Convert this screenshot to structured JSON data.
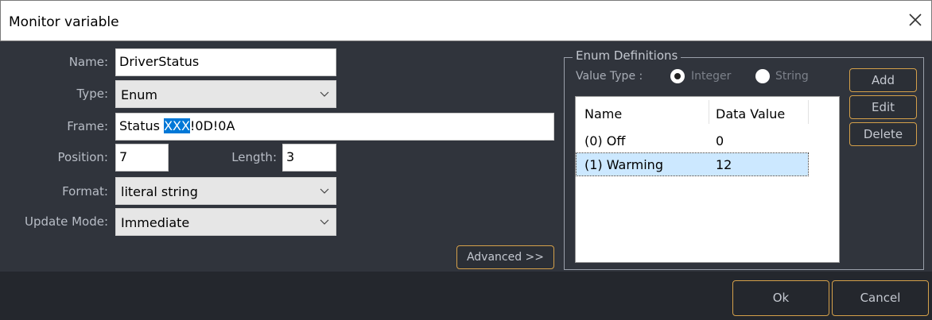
{
  "window": {
    "title": "Monitor variable"
  },
  "form": {
    "name_label": "Name:",
    "name_value": "DriverStatus",
    "type_label": "Type:",
    "type_value": "Enum",
    "frame_label": "Frame:",
    "frame_prefix": "Status ",
    "frame_selected": "XXX",
    "frame_suffix": "!0D!0A",
    "position_label": "Position:",
    "position_value": "7",
    "length_label": "Length:",
    "length_value": "3",
    "format_label": "Format:",
    "format_value": "literal string",
    "update_mode_label": "Update Mode:",
    "update_mode_value": "Immediate",
    "advanced_label": "Advanced >>"
  },
  "enum": {
    "group_title": "Enum Definitions",
    "value_type_label": "Value Type :",
    "integer_label": "Integer",
    "string_label": "String",
    "selected_value_type": "Integer",
    "columns": [
      "Name",
      "Data Value"
    ],
    "rows": [
      {
        "name": "(0) Off",
        "value": "0"
      },
      {
        "name": "(1) Warming",
        "value": "12"
      }
    ],
    "selected_row": 1,
    "add_label": "Add",
    "edit_label": "Edit",
    "delete_label": "Delete"
  },
  "footer": {
    "ok_label": "Ok",
    "cancel_label": "Cancel"
  },
  "icons": {
    "close": "close-icon",
    "chevron": "chevron-down-icon"
  },
  "colors": {
    "accent": "#d4a04a",
    "selection": "#0078d7",
    "row_selection": "#cce8ff"
  }
}
